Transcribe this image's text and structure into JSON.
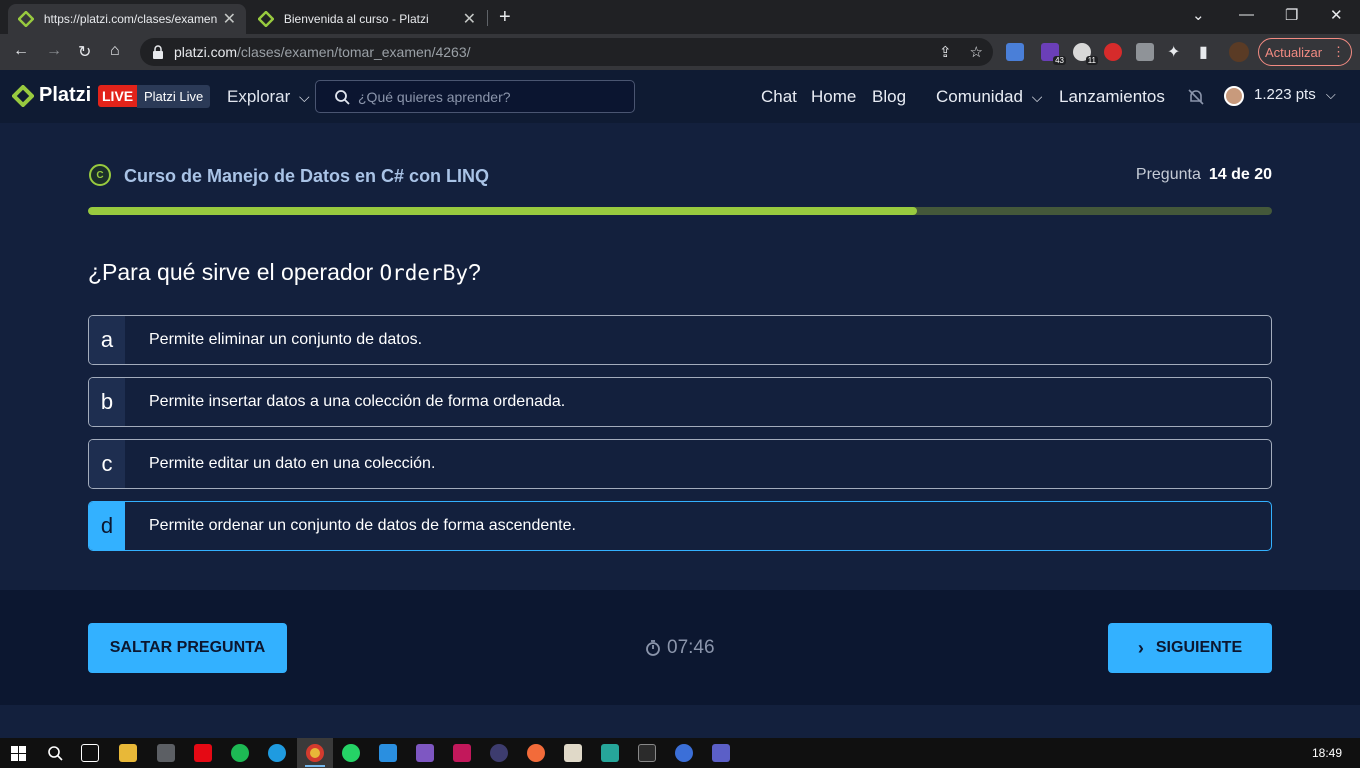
{
  "browser": {
    "tabs": [
      {
        "title": "https://platzi.com/clases/examen",
        "active": true
      },
      {
        "title": "Bienvenida al curso - Platzi",
        "active": false
      }
    ],
    "url_host": "platzi.com",
    "url_path": "/clases/examen/tomar_examen/4263/",
    "extensions": [
      {
        "icon": "translate-icon"
      },
      {
        "icon": "ext-purple-icon",
        "badge": "43"
      },
      {
        "icon": "ext-red-icon",
        "badge": "11"
      },
      {
        "icon": "ext-video-icon"
      },
      {
        "icon": "ext-edit-icon"
      }
    ],
    "update_label": "Actualizar",
    "accent": "#f28b82"
  },
  "header": {
    "logo_text": "Platzi",
    "live_badge": "LIVE",
    "live_label": "Platzi Live",
    "explore_label": "Explorar",
    "search_placeholder": "¿Qué quieres aprender?",
    "nav": [
      "Chat",
      "Home",
      "Blog",
      "Comunidad",
      "Lanzamientos"
    ],
    "points": "1.223 pts"
  },
  "exam": {
    "course_title": "Curso de Manejo de Datos en C# con LINQ",
    "question_label": "Pregunta",
    "question_counter": "14 de 20",
    "progress_fraction": 0.7,
    "question_prefix": "¿Para qué sirve el operador ",
    "question_code": "OrderBy",
    "question_suffix": "?",
    "options": [
      {
        "letter": "a",
        "text": "Permite eliminar un conjunto de datos.",
        "selected": false
      },
      {
        "letter": "b",
        "text": "Permite insertar datos a una colección de forma ordenada.",
        "selected": false
      },
      {
        "letter": "c",
        "text": "Permite editar un dato en una colección.",
        "selected": false
      },
      {
        "letter": "d",
        "text": "Permite ordenar un conjunto de datos de forma ascendente.",
        "selected": true
      }
    ],
    "skip_label": "SALTAR PREGUNTA",
    "timer": "07:46",
    "next_label": "SIGUIENTE",
    "colors": {
      "primary": "#33b1ff",
      "progress": "#98ca3f",
      "background": "#13203d"
    }
  },
  "taskbar": {
    "clock": "18:49"
  }
}
